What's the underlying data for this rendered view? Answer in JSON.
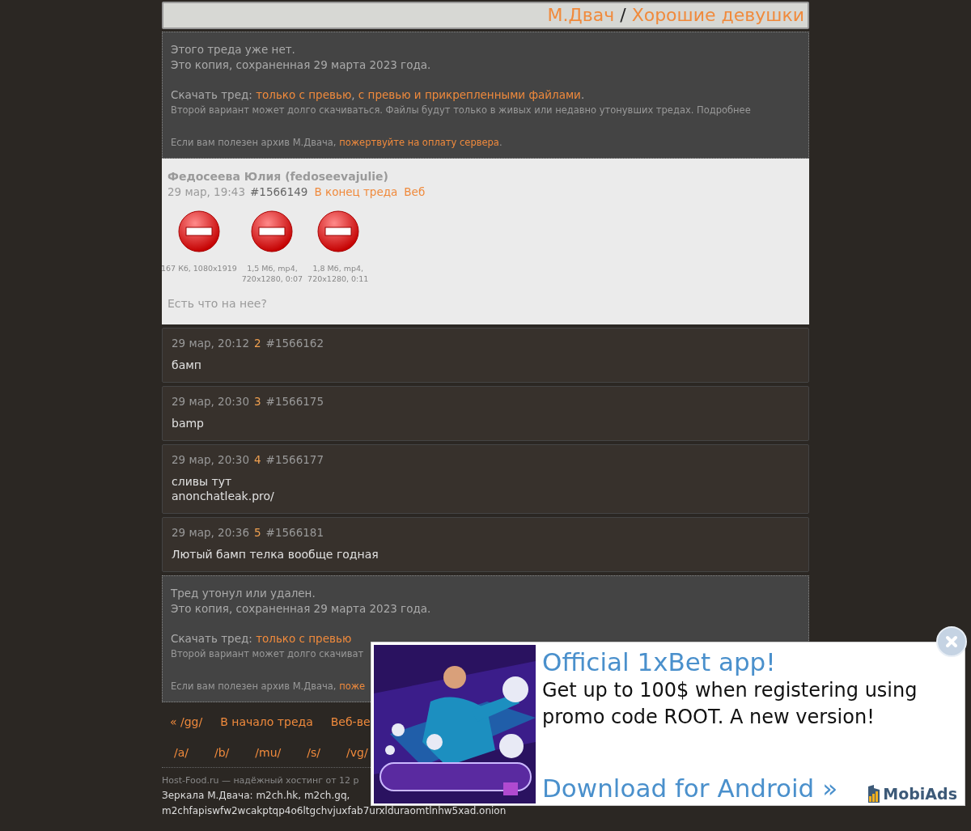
{
  "header": {
    "site": "М.Двач",
    "separator": "/",
    "board": "Хорошие девушки"
  },
  "notices": [
    {
      "status": "Этого треда уже нет.",
      "saved": "Это копия, сохраненная 29 марта 2023 года.",
      "download": [
        {
          "kind": "plain",
          "text": "Скачать тред: "
        },
        {
          "kind": "link",
          "text": "только с превью"
        },
        {
          "kind": "plain",
          "text": ", "
        },
        {
          "kind": "link",
          "text": "с превью и прикрепленными файлами"
        },
        {
          "kind": "plain",
          "text": "."
        }
      ],
      "hint": "Второй вариант может долго скачиваться. Файлы будут только в живых или недавно утонувших тредах. Подробнее",
      "donate": [
        {
          "kind": "plain",
          "text": "Если вам полезен архив М.Двача, "
        },
        {
          "kind": "link",
          "text": "пожертвуйте на оплату сервера"
        },
        {
          "kind": "plain",
          "text": "."
        }
      ]
    },
    {
      "status": "Тред утонул или удален.",
      "saved": "Это копия, сохраненная 29 марта 2023 года.",
      "download": [
        {
          "kind": "plain",
          "text": "Скачать тред: "
        },
        {
          "kind": "link",
          "text": "только с превью"
        }
      ],
      "hint": "Второй вариант может долго скачиват",
      "donate": [
        {
          "kind": "plain",
          "text": "Если вам полезен архив М.Двача, "
        },
        {
          "kind": "link",
          "text": "поже"
        }
      ]
    }
  ],
  "op": {
    "author": "Федосеева Юлия (fedoseevajulie)",
    "date": "29 мар, 19:43",
    "number": "#1566149",
    "links": [
      "В конец треда",
      "Веб"
    ],
    "files": [
      {
        "info": [
          "167 Кб, 1080x1919"
        ]
      },
      {
        "info": [
          "1,5 Мб, mp4,",
          "720x1280, 0:07"
        ]
      },
      {
        "info": [
          "1,8 Мб, mp4,",
          "720x1280, 0:11"
        ]
      }
    ],
    "text": "Есть что на нее?"
  },
  "replies": [
    {
      "date": "29 мар, 20:12",
      "index": "2",
      "number": "#1566162",
      "lines": [
        "бамп"
      ]
    },
    {
      "date": "29 мар, 20:30",
      "index": "3",
      "number": "#1566175",
      "lines": [
        "bamp"
      ]
    },
    {
      "date": "29 мар, 20:30",
      "index": "4",
      "number": "#1566177",
      "lines": [
        "сливы тут",
        "anonchatleak.pro/"
      ]
    },
    {
      "date": "29 мар, 20:36",
      "index": "5",
      "number": "#1566181",
      "lines": [
        "Лютый бамп телка вообще годная"
      ]
    }
  ],
  "nav": [
    "« /gg/",
    "В начало треда",
    "Веб-ве"
  ],
  "boards": [
    "/a/",
    "/b/",
    "/mu/",
    "/s/",
    "/vg/"
  ],
  "footer": {
    "hosting": "Host-Food.ru — надёжный хостинг от 12 р",
    "mirrors": "Зеркала М.Двача: m2ch.hk, m2ch.gq,",
    "onion": "m2chfapiswfw2wcakptqp4o6ltgchvjuxfab7urxlduraomtlnhw5xad.onion"
  },
  "ad": {
    "title": "Official 1xBet app!",
    "body": "Get up to 100$ when registering using promo code ROOT. A new version!",
    "cta": "Download for Android »",
    "brand": "MobiAds"
  }
}
